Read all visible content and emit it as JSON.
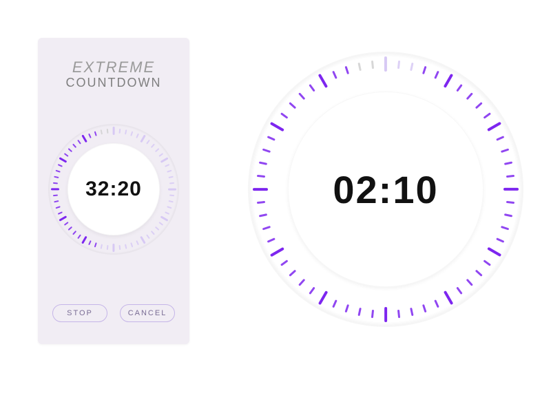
{
  "colors": {
    "accent": "#7d26ef",
    "tick_dim": "#d7c9f4",
    "tick_off": "#d0d0d0",
    "card_bg": "#f1edf4",
    "btn_border": "#c5b5e8",
    "title_gray": "#7f7f7f"
  },
  "header": {
    "line1": "EXTREME",
    "line2": "COUNTDOWN"
  },
  "small_timer": {
    "time": "32:20",
    "progress_fraction": 0.55,
    "tick_count": 60
  },
  "large_timer": {
    "time": "02:10",
    "progress_fraction": 0.05,
    "tick_count": 60
  },
  "buttons": {
    "stop": "STOP",
    "cancel": "CANCEL"
  }
}
